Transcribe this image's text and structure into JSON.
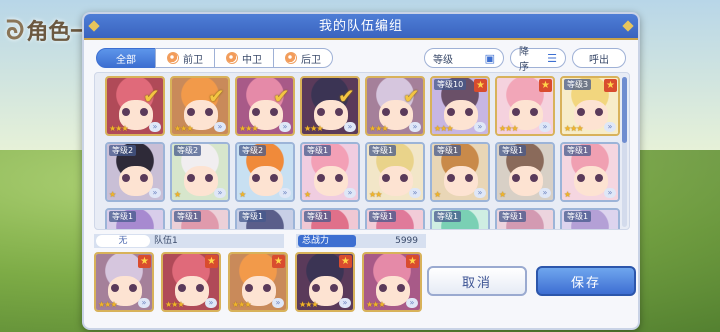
{
  "background": {
    "title": "角色一览"
  },
  "dialog": {
    "title": "我的队伍编组"
  },
  "filters": {
    "tabs": [
      {
        "label": "全部",
        "active": true
      },
      {
        "label": "前卫",
        "active": false
      },
      {
        "label": "中卫",
        "active": false
      },
      {
        "label": "后卫",
        "active": false
      }
    ],
    "sort_label": "等级",
    "order_label": "降序",
    "clear_label": "呼出"
  },
  "roster": {
    "row1": [
      {
        "level": "",
        "stars": "★★★",
        "selected": true,
        "hair": "#e06a7a",
        "bg": "#b04a58"
      },
      {
        "level": "",
        "stars": "★★★",
        "selected": true,
        "hair": "#f29a4a",
        "bg": "#c98a5a"
      },
      {
        "level": "",
        "stars": "★★★",
        "selected": true,
        "hair": "#e58aa8",
        "bg": "#a85a88"
      },
      {
        "level": "",
        "stars": "★★★",
        "selected": true,
        "hair": "#3b3454",
        "bg": "#5a3a5a"
      },
      {
        "level": "",
        "stars": "★★★",
        "selected": true,
        "hair": "#d6c6de",
        "bg": "#a5809a"
      },
      {
        "level": "等级10",
        "stars": "★★★",
        "selected": false,
        "hair": "#6a5068",
        "bg": "#c7b6e2"
      },
      {
        "level": "",
        "stars": "★★★",
        "selected": false,
        "hair": "#f2a6b8",
        "bg": "#f5d2de"
      },
      {
        "level": "等级3",
        "stars": "★★★",
        "selected": false,
        "hair": "#f2d67e",
        "bg": "#f7ecc8"
      }
    ],
    "row2": [
      {
        "level": "等级2",
        "stars": "★",
        "hair": "#2e2a38",
        "bg": "#c9bfd6"
      },
      {
        "level": "等级2",
        "stars": "★",
        "hair": "#f1eef0",
        "bg": "#d7e6cc"
      },
      {
        "level": "等级2",
        "stars": "★",
        "hair": "#f08a3a",
        "bg": "#c8e0f2"
      },
      {
        "level": "等级1",
        "stars": "★",
        "hair": "#f3a0b6",
        "bg": "#f0cde0"
      },
      {
        "level": "等级1",
        "stars": "★★",
        "hair": "#e9d38a",
        "bg": "#f2e6c8"
      },
      {
        "level": "等级1",
        "stars": "★",
        "hair": "#c98a4a",
        "bg": "#e9d6b6"
      },
      {
        "level": "等级1",
        "stars": "★",
        "hair": "#8a6a5a",
        "bg": "#d8d0c6"
      },
      {
        "level": "等级1",
        "stars": "★",
        "hair": "#f0a0b2",
        "bg": "#f5d6e0"
      }
    ],
    "row3": [
      {
        "level": "等级1",
        "hair": "#a78ad0",
        "bg": "#d8cdea"
      },
      {
        "level": "等级1",
        "hair": "#e09aac",
        "bg": "#ecd0d8"
      },
      {
        "level": "等级1",
        "hair": "#5a5e8a",
        "bg": "#c8cfe6"
      },
      {
        "level": "等级1",
        "hair": "#e0708a",
        "bg": "#f0c8d4"
      },
      {
        "level": "等级1",
        "hair": "#e07a9a",
        "bg": "#f2ccd8"
      },
      {
        "level": "等级1",
        "hair": "#7ad0b4",
        "bg": "#cfeee2"
      },
      {
        "level": "等级1",
        "hair": "#d39ab2",
        "bg": "#ecd4de"
      },
      {
        "level": "等级1",
        "hair": "#b4a0d6",
        "bg": "#ddd4ee"
      }
    ]
  },
  "party": {
    "slot_label": "无",
    "name": "队伍1",
    "power_label": "总战力",
    "power_value": "5999",
    "members": [
      {
        "stars": "★★★",
        "hair": "#d6c6de",
        "bg": "#a5809a"
      },
      {
        "stars": "★★★",
        "hair": "#e06a7a",
        "bg": "#b04a58"
      },
      {
        "stars": "★★★",
        "hair": "#f29a4a",
        "bg": "#c98a5a"
      },
      {
        "stars": "★★★",
        "hair": "#3b3454",
        "bg": "#5a3a5a"
      },
      {
        "stars": "★★★",
        "hair": "#e58aa8",
        "bg": "#a85a88"
      }
    ]
  },
  "buttons": {
    "cancel": "取消",
    "save": "保存"
  }
}
